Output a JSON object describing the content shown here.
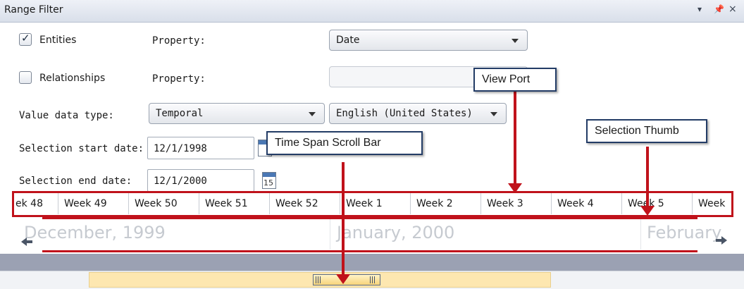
{
  "titlebar": {
    "title": "Range Filter",
    "controls": [
      "▾",
      "ᵒ",
      "×"
    ]
  },
  "form": {
    "entities": {
      "label": "Entities",
      "checked": true,
      "property_label": "Property:",
      "property_value": "Date"
    },
    "relationships": {
      "label": "Relationships",
      "checked": false,
      "property_label": "Property:",
      "property_value": ""
    },
    "value_type": {
      "label": "Value data type:",
      "value": "Temporal",
      "culture": "English (United States)"
    },
    "start": {
      "label": "Selection start date:",
      "value": "12/1/1998"
    },
    "end": {
      "label": "Selection end date:",
      "value": "12/1/2000",
      "calendar_day": "15"
    }
  },
  "range": {
    "weeks": [
      "ek 48",
      "Week 49",
      "Week 50",
      "Week 51",
      "Week 52",
      "Week 1",
      "Week 2",
      "Week 3",
      "Week 4",
      "Week 5",
      "Week"
    ],
    "months": [
      "December, 1999",
      "January, 2000",
      "February"
    ]
  },
  "callouts": {
    "view_port": "View Port",
    "selection_thumb": "Selection Thumb",
    "time_span": "Time Span Scroll Bar"
  }
}
